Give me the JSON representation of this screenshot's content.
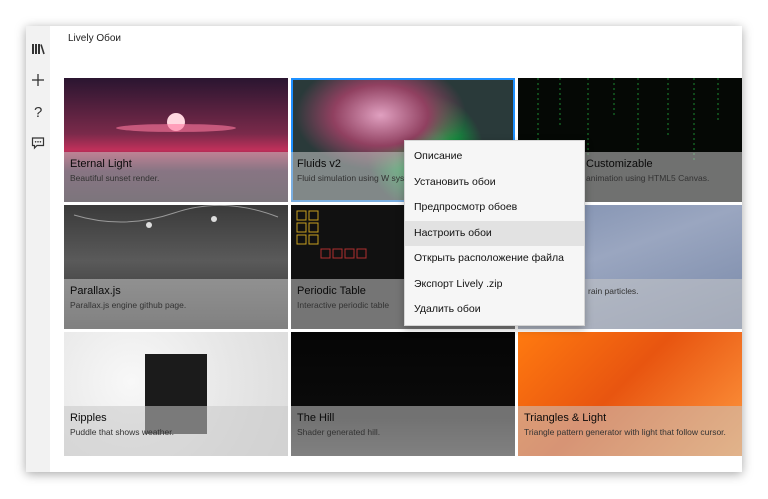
{
  "app": {
    "title": "Lively Обои"
  },
  "sidebar": {
    "items": [
      {
        "icon": "library-icon",
        "glyph": "𝄃\\"
      },
      {
        "icon": "plus-icon",
        "glyph": "+"
      },
      {
        "icon": "help-icon",
        "glyph": "?"
      },
      {
        "icon": "feedback-icon",
        "glyph": "💬"
      }
    ]
  },
  "tiles": [
    {
      "title": "Eternal Light",
      "desc": "Beautiful sunset render."
    },
    {
      "title": "Fluids v2",
      "desc": "Fluid simulation using W system audio & cursor."
    },
    {
      "title": "Customizable",
      "desc": "animation using HTML5 Canvas."
    },
    {
      "title": "Parallax.js",
      "desc": "Parallax.js engine github page."
    },
    {
      "title": "Periodic Table",
      "desc": "Interactive periodic table"
    },
    {
      "title": "",
      "desc": "rain particles."
    },
    {
      "title": "Ripples",
      "desc": "Puddle that shows weather."
    },
    {
      "title": "The Hill",
      "desc": "Shader generated hill."
    },
    {
      "title": "Triangles & Light",
      "desc": "Triangle pattern generator with light that follow cursor."
    }
  ],
  "context_menu": {
    "items": [
      "Описание",
      "Установить обои",
      "Предпросмотр обоев",
      "Настроить обои",
      "Открыть расположение файла",
      "Экспорт Lively .zip",
      "Удалить обои"
    ],
    "highlighted_index": 3
  },
  "colors": {
    "accent": "#1e90ff",
    "menu_hover": "#e2e2e2"
  }
}
